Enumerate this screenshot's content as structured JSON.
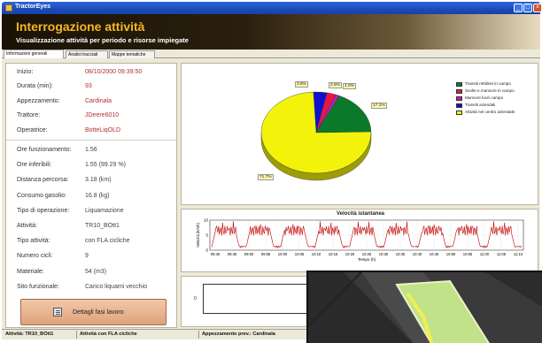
{
  "window": {
    "title": "TractorEyes"
  },
  "header": {
    "title": "Interrogazione attività",
    "subtitle": "Visualizzazione attività per periodo e risorse impiegate"
  },
  "tabs": [
    {
      "label": "Informazioni generali"
    },
    {
      "label": "Analisi tracciati"
    },
    {
      "label": "Mappe tematiche"
    }
  ],
  "info": {
    "group1": [
      {
        "label": "Inizio:",
        "value": "08/10/2000 09:39:50"
      },
      {
        "label": "Durata (min):",
        "value": "93"
      },
      {
        "label": "Appezzamento:",
        "value": "Cardinala"
      },
      {
        "label": "Trattore:",
        "value": "JDeere6010"
      },
      {
        "label": "Operatrice:",
        "value": "BotteLiqOLD"
      }
    ],
    "group2": [
      {
        "label": "Ore funzionamento:",
        "value": "1.56"
      },
      {
        "label": "Ore inferibili:",
        "value": "1.55 (99.29 %)"
      },
      {
        "label": "Distanza percorsa:",
        "value": "3.18 (km)"
      },
      {
        "label": "Consumo gasolio:",
        "value": "16.8 (kg)"
      },
      {
        "label": "Tipo di operazione:",
        "value": "Liquamazione"
      },
      {
        "label": "Attività:",
        "value": "TR10_BOtt1"
      },
      {
        "label": "Tipo attività:",
        "value": "con FLA cicliche"
      },
      {
        "label": "Numero cicli:",
        "value": "9"
      },
      {
        "label": "Materiale:",
        "value": "54 (m3)"
      },
      {
        "label": "Sito funzionale:",
        "value": "Carico liquami vecchio"
      }
    ],
    "details_button": "Dettagli fasi lavoro"
  },
  "chart_data": [
    {
      "type": "pie",
      "categories": [
        "Transiti rettilinei in campo",
        "Svolte e manovre in campo",
        "Manovre fuori campo",
        "Transiti aziendali",
        "Attività nel centro aziendale"
      ],
      "values": [
        17.1,
        2.6,
        1.0,
        3.8,
        71.7
      ],
      "labels": [
        "17.1%",
        "2.6%",
        "1.0%",
        "3.8%",
        "71.7%"
      ],
      "colors": [
        "#0a7a2a",
        "#e8154a",
        "#c01ac0",
        "#1010d0",
        "#f2f20a"
      ],
      "legend": "top-right"
    },
    {
      "type": "line",
      "title": "Velocità istantanea",
      "xlabel": "Tempo (h)",
      "ylabel": "Velocità (km/h)",
      "x_ticks": [
        "09:40",
        "09:45",
        "09:50",
        "09:55",
        "10:00",
        "10:05",
        "10:10",
        "10:15",
        "10:20",
        "10:25",
        "10:30",
        "10:35",
        "10:40",
        "10:45",
        "10:50",
        "10:55",
        "11:00",
        "11:05",
        "11:10"
      ],
      "y_ticks": [
        "0",
        "5",
        "10"
      ],
      "ylim": [
        0,
        10
      ],
      "series_color": "#c00000",
      "grid": true
    }
  ],
  "lower_chart": {
    "zero_label": "0"
  },
  "statusbar": {
    "activity": "Attività: TR10_BOtt1",
    "type": "Attività con FLA cicliche",
    "field": "Appezzamento prev.: Cardinala"
  }
}
